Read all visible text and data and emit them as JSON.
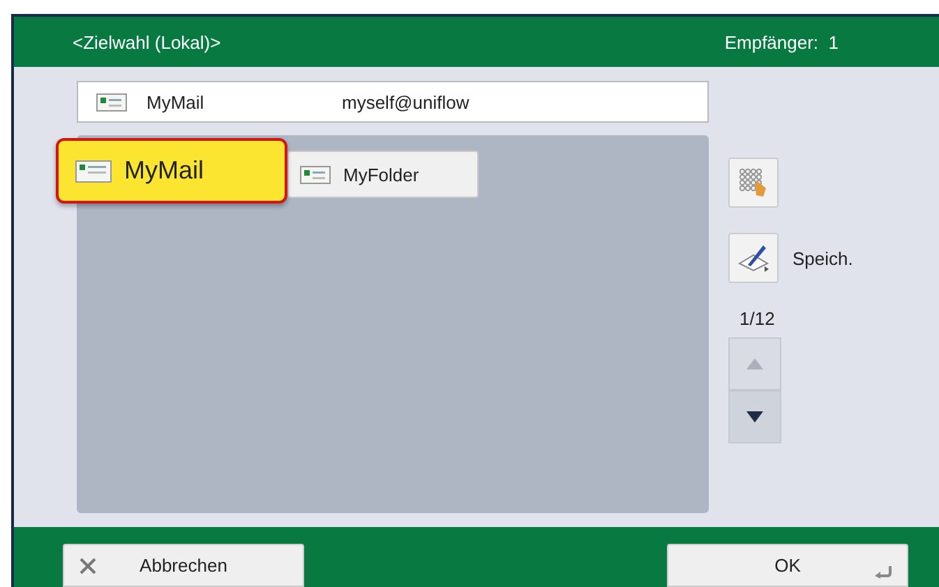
{
  "header": {
    "title": "<Zielwahl (Lokal)>",
    "recipients": "Empfänger:  1"
  },
  "recipient": {
    "name": "MyMail",
    "address": "myself@uniflow"
  },
  "destinations": [
    {
      "label": "MyMail",
      "selected": true
    },
    {
      "label": "MyFolder",
      "selected": false
    }
  ],
  "tools": [
    {
      "kind": "grid"
    },
    {
      "kind": "store",
      "label": "Speich."
    }
  ],
  "page": "1/12",
  "scroll": [
    {
      "kind": "up",
      "disabled": true
    },
    {
      "kind": "down",
      "disabled": false
    }
  ],
  "footer": [
    {
      "kind": "cancel",
      "label": "Abbrechen"
    },
    {
      "kind": "ok",
      "label": "OK"
    }
  ]
}
